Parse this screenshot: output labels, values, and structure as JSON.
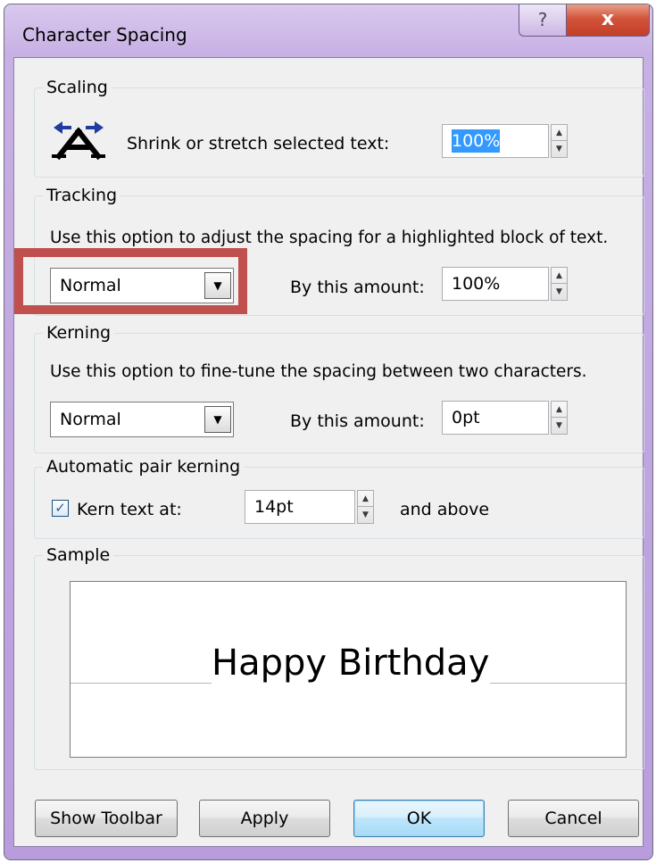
{
  "window": {
    "title": "Character Spacing",
    "help_label": "?",
    "close_label": "x"
  },
  "scaling": {
    "legend": "Scaling",
    "icon": "stretch-text-icon",
    "label": "Shrink or stretch selected text:",
    "value": "100%"
  },
  "tracking": {
    "legend": "Tracking",
    "description": "Use this option to adjust the spacing for a highlighted block of text.",
    "selected": "Normal",
    "amount_label": "By this amount:",
    "amount_value": "100%"
  },
  "kerning": {
    "legend": "Kerning",
    "description": "Use this option to fine-tune the spacing between two characters.",
    "selected": "Normal",
    "amount_label": "By this amount:",
    "amount_value": "0pt"
  },
  "auto_kerning": {
    "legend": "Automatic pair kerning",
    "checkbox_label": "Kern text at:",
    "checked": true,
    "value": "14pt",
    "suffix": "and above"
  },
  "sample": {
    "legend": "Sample",
    "text": "Happy Birthday"
  },
  "buttons": {
    "show_toolbar": "Show Toolbar",
    "apply": "Apply",
    "ok": "OK",
    "cancel": "Cancel"
  },
  "colors": {
    "highlight": "#c0504d",
    "title_bar": "#c7b0e4",
    "close_button": "#c43f28"
  }
}
